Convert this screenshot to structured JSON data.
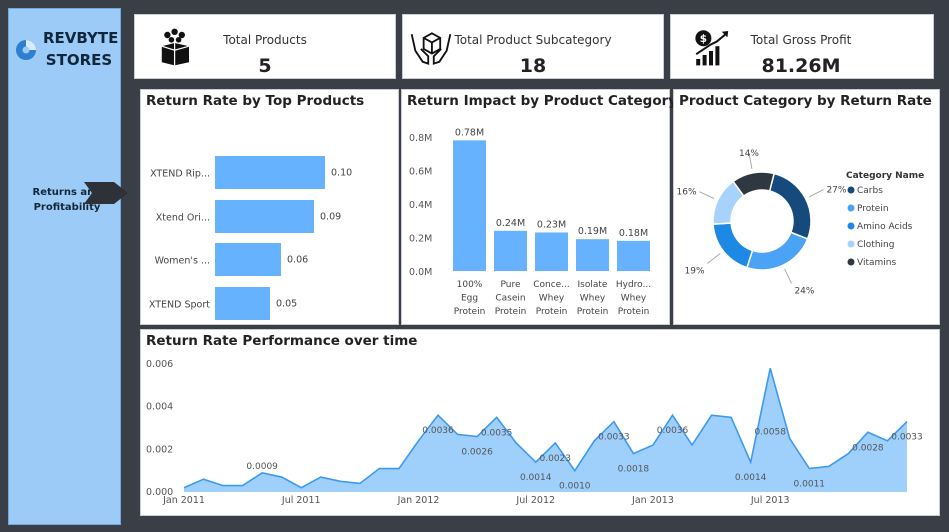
{
  "sidebar": {
    "brand_line1": "REVBYTE",
    "brand_line2": "STORES",
    "nav_label_line1": "Returns and",
    "nav_label_line2": "Profitability"
  },
  "kpis": [
    {
      "label": "Total Products",
      "value": "5",
      "icon": "people-box-icon"
    },
    {
      "label": "Total Product Subcategory",
      "value": "18",
      "icon": "hands-box-icon"
    },
    {
      "label": "Total Gross Profit",
      "value": "81.26M",
      "icon": "money-growth-icon"
    }
  ],
  "colors": {
    "bar": "#66b2ff",
    "carbs": "#174a7c",
    "protein": "#4aa3f5",
    "amino": "#1e88e5",
    "clothing": "#a7d2fb",
    "vitamins": "#2f3840",
    "area": "#9fd0fb",
    "line": "#3d99f0"
  },
  "panels": {
    "top_products_title": "Return Rate by Top Products",
    "impact_title": "Return Impact by Product Category",
    "category_title": "Product Category by Return Rate",
    "time_title": "Return Rate Performance over time"
  },
  "chart_data": [
    {
      "type": "bar",
      "orientation": "horizontal",
      "title": "Return Rate by Top Products",
      "categories": [
        "XTEND Rip...",
        "Xtend Ori...",
        "Women's ...",
        "XTEND Sport"
      ],
      "values": [
        0.1,
        0.09,
        0.06,
        0.05
      ],
      "value_labels": [
        "0.10",
        "0.09",
        "0.06",
        "0.05"
      ],
      "xlim": [
        0,
        0.2
      ]
    },
    {
      "type": "bar",
      "title": "Return Impact by Product Category",
      "categories": [
        [
          "100%",
          "Egg",
          "Protein"
        ],
        [
          "Pure",
          "Casein",
          "Protein"
        ],
        [
          "Conce...",
          "Whey",
          "Protein"
        ],
        [
          "Isolate",
          "Whey",
          "Protein"
        ],
        [
          "Hydro...",
          "Whey",
          "Protein"
        ]
      ],
      "values": [
        0.78,
        0.24,
        0.23,
        0.19,
        0.18
      ],
      "value_labels": [
        "0.78M",
        "0.24M",
        "0.23M",
        "0.19M",
        "0.18M"
      ],
      "yticks": [
        "0.0M",
        "0.2M",
        "0.4M",
        "0.6M",
        "0.8M"
      ],
      "ylim": [
        0,
        0.8
      ]
    },
    {
      "type": "pie",
      "subtype": "donut",
      "title": "Product Category by Return Rate",
      "legend_title": "Category Name",
      "legend_position": "right",
      "slices": [
        {
          "name": "Carbs",
          "value": 27,
          "label": "27%"
        },
        {
          "name": "Protein",
          "value": 24,
          "label": "24%"
        },
        {
          "name": "Amino Acids",
          "value": 19,
          "label": "19%"
        },
        {
          "name": "Clothing",
          "value": 16,
          "label": "16%"
        },
        {
          "name": "Vitamins",
          "value": 14,
          "label": "14%"
        }
      ]
    },
    {
      "type": "area",
      "title": "Return Rate Performance over time",
      "x_ticks": [
        "Jan 2011",
        "Jul 2011",
        "Jan 2012",
        "Jul 2012",
        "Jan 2013",
        "Jul 2013"
      ],
      "x_tick_months": [
        0,
        6,
        12,
        18,
        24,
        30
      ],
      "yticks": [
        "0.000",
        "0.002",
        "0.004",
        "0.006"
      ],
      "ylim": [
        0,
        0.006
      ],
      "values": [
        0.0002,
        0.0006,
        0.0003,
        0.0003,
        0.0009,
        0.0007,
        0.0002,
        0.0007,
        0.0005,
        0.0004,
        0.0011,
        0.0011,
        0.0024,
        0.0036,
        0.0027,
        0.0026,
        0.0035,
        0.0023,
        0.0014,
        0.0023,
        0.001,
        0.0024,
        0.0033,
        0.0018,
        0.0022,
        0.0036,
        0.0022,
        0.0036,
        0.0035,
        0.0014,
        0.0058,
        0.0025,
        0.0011,
        0.0012,
        0.0018,
        0.0028,
        0.0024,
        0.0033
      ],
      "data_labels": [
        {
          "index": 4,
          "text": "0.0009"
        },
        {
          "index": 13,
          "text": "0.0036"
        },
        {
          "index": 15,
          "text": "0.0026"
        },
        {
          "index": 16,
          "text": "0.0035"
        },
        {
          "index": 18,
          "text": "0.0014"
        },
        {
          "index": 19,
          "text": "0.0023"
        },
        {
          "index": 20,
          "text": "0.0010"
        },
        {
          "index": 22,
          "text": "0.0033"
        },
        {
          "index": 23,
          "text": "0.0018"
        },
        {
          "index": 25,
          "text": "0.0036"
        },
        {
          "index": 29,
          "text": "0.0014"
        },
        {
          "index": 30,
          "text": "0.0058"
        },
        {
          "index": 32,
          "text": "0.0011"
        },
        {
          "index": 35,
          "text": "0.0028"
        },
        {
          "index": 37,
          "text": "0.0033"
        }
      ]
    }
  ]
}
